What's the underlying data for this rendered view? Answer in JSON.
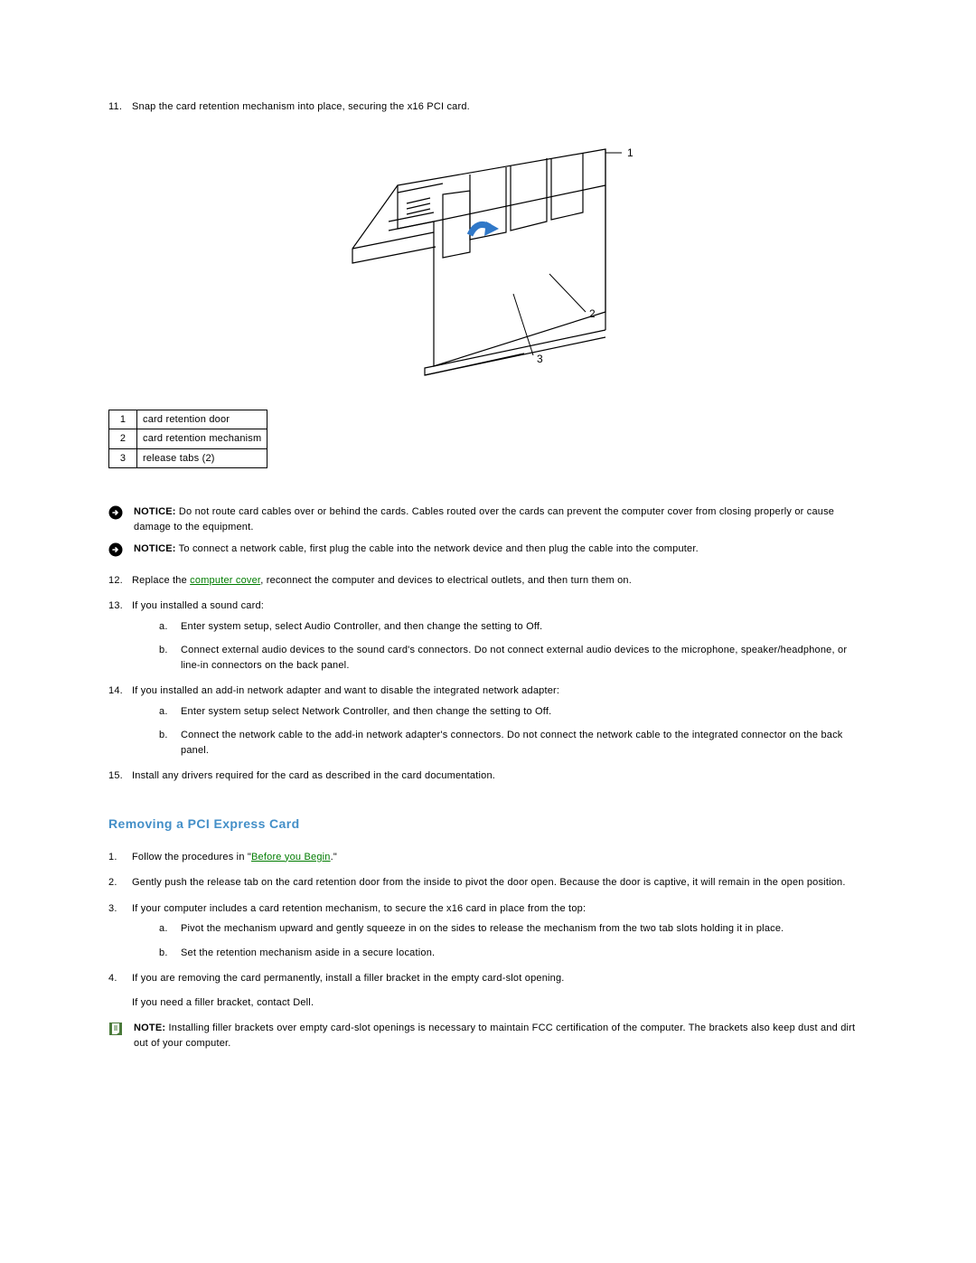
{
  "step11_no": "11.",
  "step11": "Snap the card retention mechanism into place, securing the x16 PCI card.",
  "callout": {
    "r1n": "1",
    "r1t": "card retention door",
    "r2n": "2",
    "r2t": "card retention mechanism",
    "r3n": "3",
    "r3t": "release tabs (2)"
  },
  "diagram_labels": {
    "l1": "1",
    "l2": "2",
    "l3": "3"
  },
  "notice1_label": "NOTICE:",
  "notice1": " Do not route card cables over or behind the cards. Cables routed over the cards can prevent the computer cover from closing properly or cause damage to the equipment.",
  "notice2_label": "NOTICE:",
  "notice2": " To connect a network cable, first plug the cable into the network device and then plug the cable into the computer.",
  "step12_no": "12.",
  "step12_a": "Replace the ",
  "step12_link": "computer cover",
  "step12_b": ", reconnect the computer and devices to electrical outlets, and then turn them on.",
  "step13_no": "13.",
  "step13": "If you installed a sound card:",
  "step13a_lt": "a.",
  "step13a": "Enter system setup, select Audio Controller, and then change the setting to Off.",
  "step13b_lt": "b.",
  "step13b": "Connect external audio devices to the sound card's connectors. Do not connect external audio devices to the microphone, speaker/headphone, or line-in connectors on the back panel.",
  "step14_no": "14.",
  "step14": "If you installed an add-in network adapter and want to disable the integrated network adapter:",
  "step14a_lt": "a.",
  "step14a": "Enter system setup select Network Controller, and then change the setting to Off.",
  "step14b_lt": "b.",
  "step14b": "Connect the network cable to the add-in network adapter's connectors. Do not connect the network cable to the integrated connector on the back panel.",
  "step15_no": "15.",
  "step15": "Install any drivers required for the card as described in the card documentation.",
  "section_title": "Removing a PCI Express Card",
  "r1_no": "1.",
  "r1_a": "Follow the procedures in \"",
  "r1_link": "Before you Begin",
  "r1_b": ".\"",
  "r2_no": "2.",
  "r2": "Gently push the release tab on the card retention door from the inside to pivot the door open. Because the door is captive, it will remain in the open position.",
  "r3_no": "3.",
  "r3": "If your computer includes a card retention mechanism, to secure the x16 card in place from the top:",
  "r3a_lt": "a.",
  "r3a": "Pivot the mechanism upward and gently squeeze in on the sides to release the mechanism from the two tab slots holding it in place.",
  "r3b_lt": "b.",
  "r3b": "Set the retention mechanism aside in a secure location.",
  "r4_no": "4.",
  "r4": "If you are removing the card permanently, install a filler bracket in the empty card-slot opening.",
  "r4_extra": "If you need a filler bracket, contact Dell.",
  "note_label": "NOTE:",
  "note": " Installing filler brackets over empty card-slot openings is necessary to maintain FCC certification of the computer. The brackets also keep dust and dirt out of your computer."
}
